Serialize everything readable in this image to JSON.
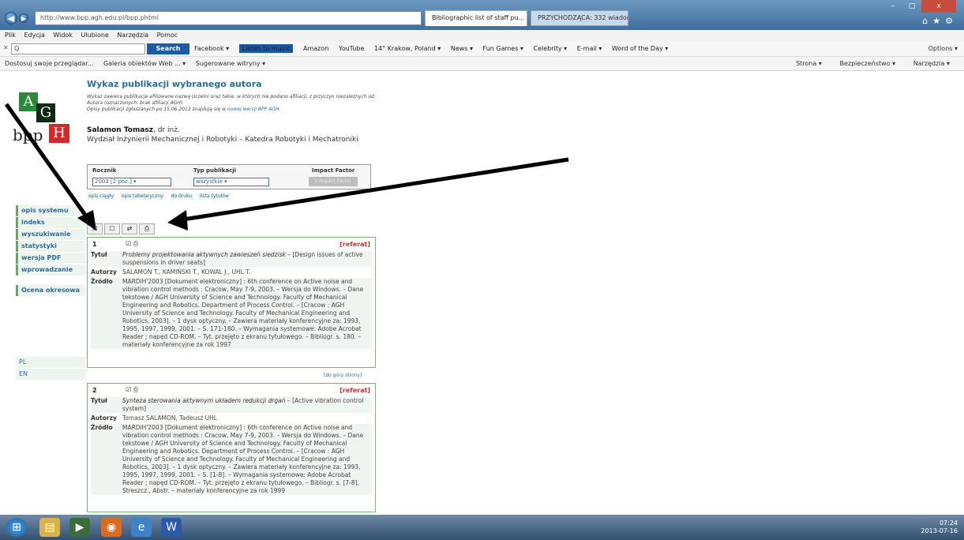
{
  "browser": {
    "address": "http://www.bpp.agh.edu.pl/bpp.phtml",
    "address_host": "www.bpp.agh.edu.pl",
    "tab_active": "Bibliographic list of staff pu...",
    "tab_inactive": "PRZYCHODZĄCA: 332 wiadom...",
    "window_controls": {
      "min": "–",
      "max": "□",
      "close": "x"
    }
  },
  "menu": [
    "Plik",
    "Edycja",
    "Widok",
    "Ulubione",
    "Narzędzia",
    "Pomoc"
  ],
  "toolbar": {
    "search_placeholder": "Q",
    "search_label": "Search",
    "items": [
      "Facebook ▾",
      "Listen to music",
      "Amazon",
      "YouTube",
      "14° Krakow, Poland ▾",
      "News ▾",
      "Fun Games ▾",
      "Celebrity ▾",
      "E-mail ▾",
      "Word of the Day ▾"
    ],
    "options": "Options ▾"
  },
  "favorites": {
    "items": [
      "Dostosuj swoje przeglądar...",
      "Galeria obiektów Web ... ▾",
      "Sugerowane witryny ▾"
    ],
    "right": [
      "Strona ▾",
      "Bezpieczeństwo ▾",
      "Narzędzia ▾"
    ]
  },
  "logo": {
    "a": "A",
    "g": "G",
    "bpp": "bpp",
    "h": "H"
  },
  "sidebar": {
    "items": [
      "opis systemu",
      "indeks",
      "wyszukiwanie",
      "statystyki",
      "wersja PDF",
      "wprowadzanie"
    ],
    "extra": "Ocena okresowa",
    "langs": [
      "PL",
      "EN"
    ]
  },
  "main": {
    "title": "Wykaz publikacji wybranego autora",
    "note1": "Wykaz zawiera publikacje afiliowane nazwą Uczelni oraz takie, w których nie podano afiliacji, z przyczyn niezależnych od Autora (oznaczonych: brak afiliacji AGH).",
    "note2a": "Opisy publikacji zgłaszanych po 15.06.2013 znajdują się w ",
    "note2b": "nowej wersji BPP AGH.",
    "author_name": "Salamon Tomasz",
    "author_title": ", dr inż.",
    "author_dept": "Wydział Inżynierii Mechanicznej i Robotyki – Katedra Robotyki i Mechatroniki"
  },
  "filter": {
    "year_label": "Rocznik",
    "year_value": "2003 [2 poz.]",
    "type_label": "Typ publikacji",
    "type_value": "wszystkie",
    "if_label": "Impact Factor",
    "if_button": "z Impact Factor"
  },
  "views": [
    "opis ciągły",
    "opis tabelaryczny",
    "do druku",
    "lista tytułów"
  ],
  "records": [
    {
      "num": "1",
      "badge": "[referat]",
      "title_label": "Tytuł",
      "title": "Problemy projektowania aktywnych zawieszeń siedzisk",
      "title_en": " – [Design issues of active suspensions in driver seats]",
      "authors_label": "Autorzy",
      "authors": "SALAMON T., KAMIŃSKI T., KOWAL J., UHL T.",
      "source_label": "Źródło",
      "source": "MARDiH'2003 [Dokument elektroniczny] : 6th conference on Active noise and vibration control methods : Cracow, May 7-9, 2003. – Wersja do Windows. – Dane tekstowe / AGH University of Science and Technology. Faculty of Mechanical Engineering and Robotics. Department of Process Control. – [Cracow : AGH University of Science and Technology. Faculty of Mechanical Engineering and Robotics, 2003]. – 1 dysk optyczny. – Zawiera materiały konferencyjne za: 1993, 1995, 1997, 1999, 2001. – S. 171-180. – Wymagania systemowe: Adobe Acrobat Reader ; napęd CD-ROM. – Tyt. przejęto z ekranu tytułowego. – Bibliogr. s. 180. – materiały konferencyjne za rok 1997"
    },
    {
      "num": "2",
      "badge": "[referat]",
      "title_label": "Tytuł",
      "title": "Synteza sterowania aktywnym układem redukcji drgań",
      "title_en": " – [Active vibration control system]",
      "authors_label": "Autorzy",
      "authors": "Tomasz SALAMON, Tadeusz UHL",
      "source_label": "Źródło",
      "source": "MARDiH'2003 [Dokument elektroniczny] : 6th conference on Active noise and vibration control methods : Cracow, May 7-9, 2003. – Wersja do Windows. – Dane tekstowe / AGH University of Science and Technology. Faculty of Mechanical Engineering and Robotics. Department of Process Control. – [Cracow : AGH University of Science and Technology. Faculty of Mechanical Engineering and Robotics, 2003]. – 1 dysk optyczny. – Zawiera materiały konferencyjne za: 1993, 1995, 1997, 1999, 2001. – S. [1-8]. – Wymagania systemowe: Adobe Acrobat Reader ; napęd CD-ROM. – Tyt. przejęto z ekranu tytułowego. – Bibliogr. s. [7-8], Streszcz., Abstr. – materiały konferencyjne za rok 1999"
    }
  ],
  "top_link": "[do góry strony]",
  "taskbar": {
    "time": "07:24",
    "date": "2013-07-16"
  }
}
